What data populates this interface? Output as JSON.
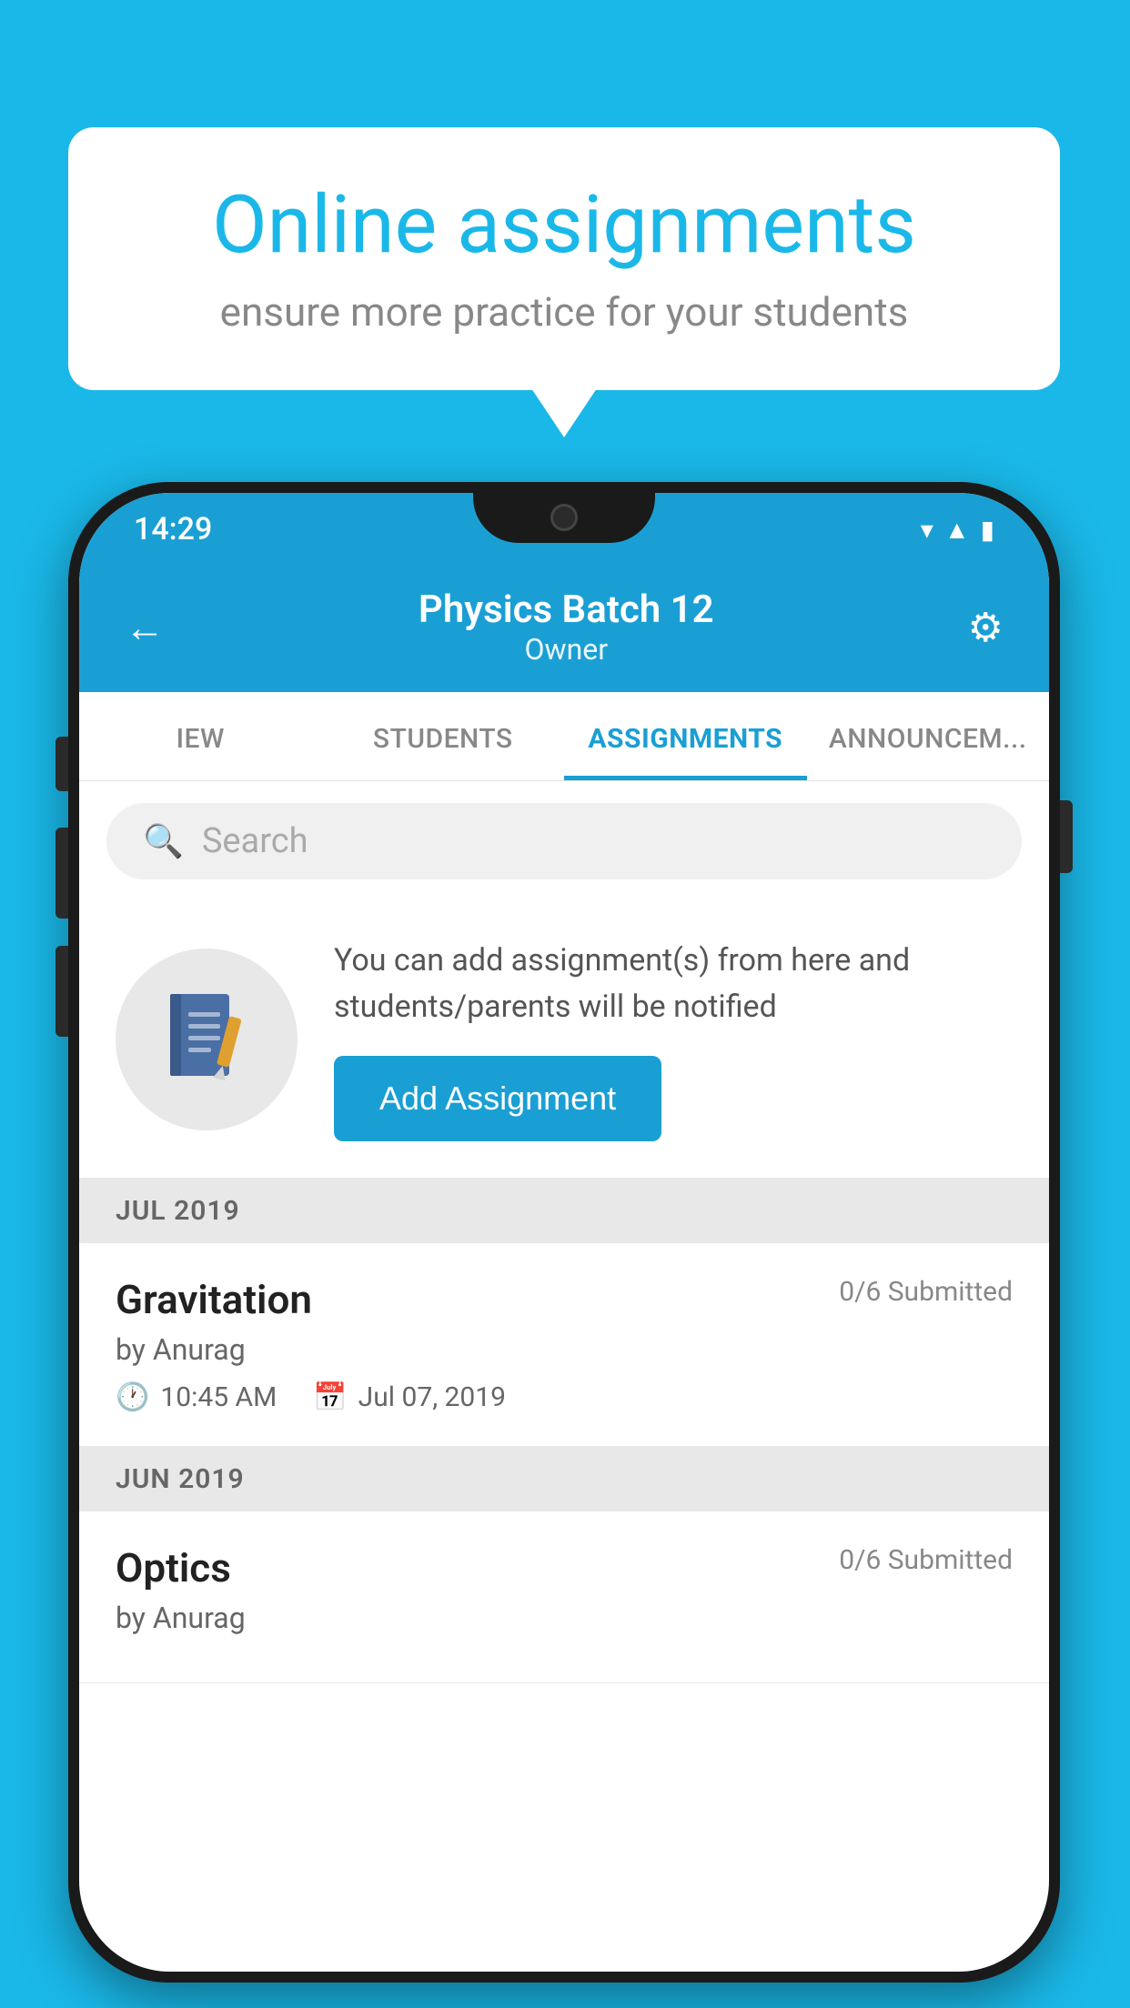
{
  "background_color": "#1ab8e8",
  "speech_bubble": {
    "title": "Online assignments",
    "subtitle": "ensure more practice for your students"
  },
  "phone": {
    "status_bar": {
      "time": "14:29",
      "icons": [
        "wifi",
        "signal",
        "battery"
      ]
    },
    "header": {
      "title": "Physics Batch 12",
      "subtitle": "Owner",
      "back_label": "←",
      "settings_label": "⚙"
    },
    "tabs": [
      {
        "label": "IEW",
        "active": false
      },
      {
        "label": "STUDENTS",
        "active": false
      },
      {
        "label": "ASSIGNMENTS",
        "active": true
      },
      {
        "label": "ANNOUNCEM...",
        "active": false
      }
    ],
    "search": {
      "placeholder": "Search"
    },
    "add_assignment_card": {
      "description": "You can add assignment(s) from here and students/parents will be notified",
      "button_label": "Add Assignment"
    },
    "sections": [
      {
        "label": "JUL 2019",
        "assignments": [
          {
            "name": "Gravitation",
            "submitted": "0/6 Submitted",
            "by": "by Anurag",
            "time": "10:45 AM",
            "date": "Jul 07, 2019"
          }
        ]
      },
      {
        "label": "JUN 2019",
        "assignments": [
          {
            "name": "Optics",
            "submitted": "0/6 Submitted",
            "by": "by Anurag",
            "time": "",
            "date": ""
          }
        ]
      }
    ]
  }
}
